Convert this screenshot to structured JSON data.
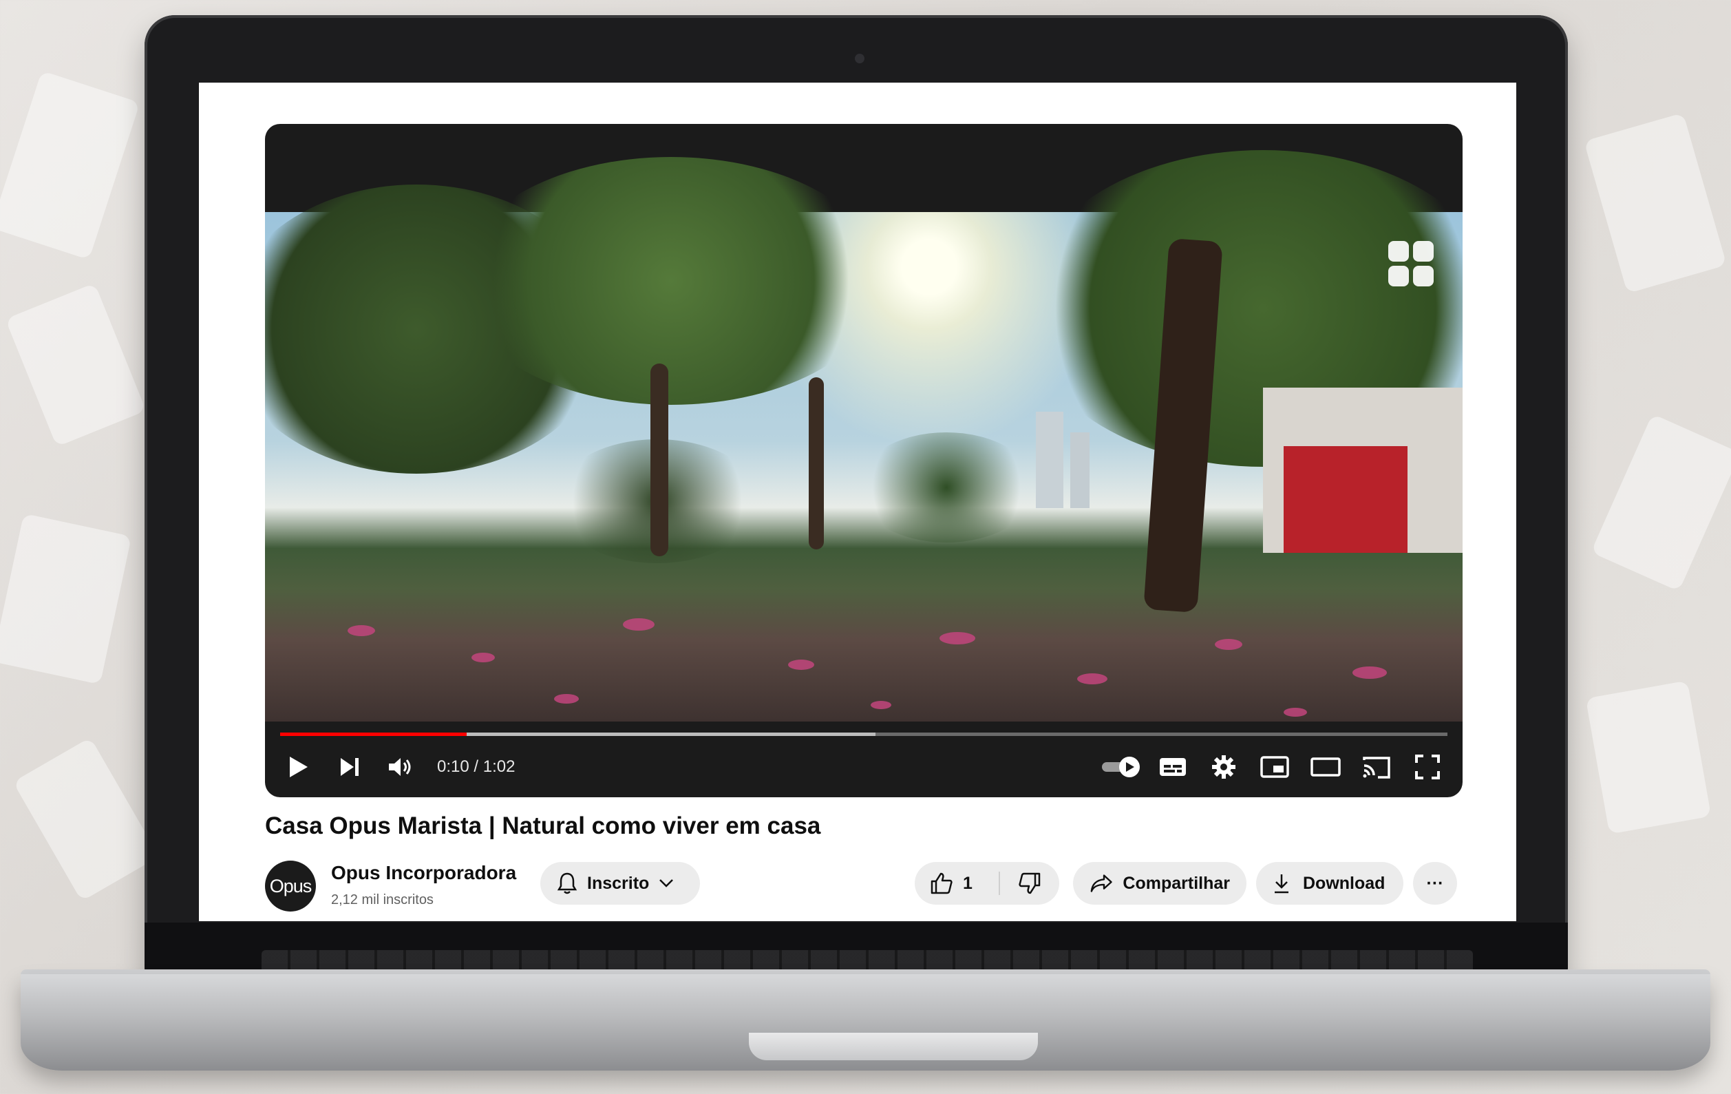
{
  "player": {
    "current_time": "0:10",
    "duration": "1:02",
    "time_display": "0:10 / 1:02",
    "progress_fraction": 0.16,
    "buffered_fraction": 0.51
  },
  "video": {
    "title": "Casa Opus Marista | Natural como viver em casa"
  },
  "channel": {
    "avatar_text": "Opus",
    "name": "Opus Incorporadora",
    "subscribers": "2,12 mil inscritos"
  },
  "actions": {
    "subscribe_label": "Inscrito",
    "like_count": "1",
    "share_label": "Compartilhar",
    "download_label": "Download",
    "more_label": "···"
  },
  "icons": [
    "play-icon",
    "next-icon",
    "volume-icon",
    "autoplay-toggle-icon",
    "subtitles-icon",
    "settings-icon",
    "miniplayer-icon",
    "theater-icon",
    "cast-icon",
    "fullscreen-icon",
    "bell-icon",
    "chevron-down-icon",
    "like-icon",
    "dislike-icon",
    "share-icon",
    "download-icon"
  ],
  "colors": {
    "progress_played": "#ff0000",
    "player_bg": "#1b1b1b",
    "pill_bg": "#ececec"
  }
}
